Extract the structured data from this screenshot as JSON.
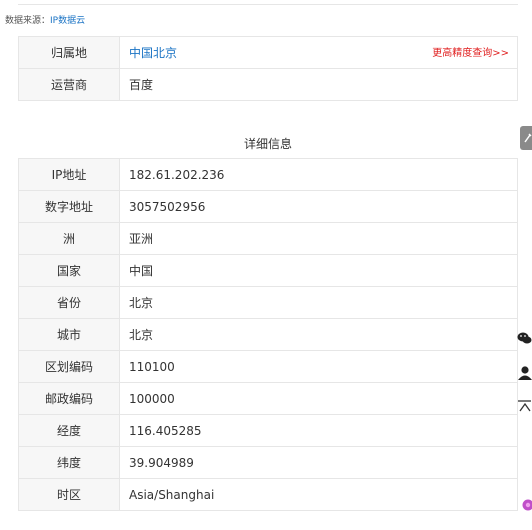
{
  "source": {
    "label": "数据来源：",
    "link_text": "IP数据云"
  },
  "location": {
    "rows": [
      {
        "key": "归属地",
        "value": "中国北京",
        "link": "更高精度查询>>"
      },
      {
        "key": "运营商",
        "value": "百度"
      }
    ]
  },
  "details": {
    "heading": "详细信息",
    "rows": [
      {
        "key": "IP地址",
        "value": "182.61.202.236"
      },
      {
        "key": "数字地址",
        "value": "3057502956"
      },
      {
        "key": "洲",
        "value": "亚洲"
      },
      {
        "key": "国家",
        "value": "中国"
      },
      {
        "key": "省份",
        "value": "北京"
      },
      {
        "key": "城市",
        "value": "北京"
      },
      {
        "key": "区划编码",
        "value": "110100"
      },
      {
        "key": "邮政编码",
        "value": "100000"
      },
      {
        "key": "经度",
        "value": "116.405285"
      },
      {
        "key": "纬度",
        "value": "39.904989"
      },
      {
        "key": "时区",
        "value": "Asia/Shanghai"
      }
    ]
  },
  "side_widgets": {
    "icons": [
      "tool-icon",
      "wechat-icon",
      "user-icon",
      "back-to-top-icon",
      "float-badge-icon"
    ],
    "accent": "#1a73c4",
    "link_red": "#e02020"
  }
}
